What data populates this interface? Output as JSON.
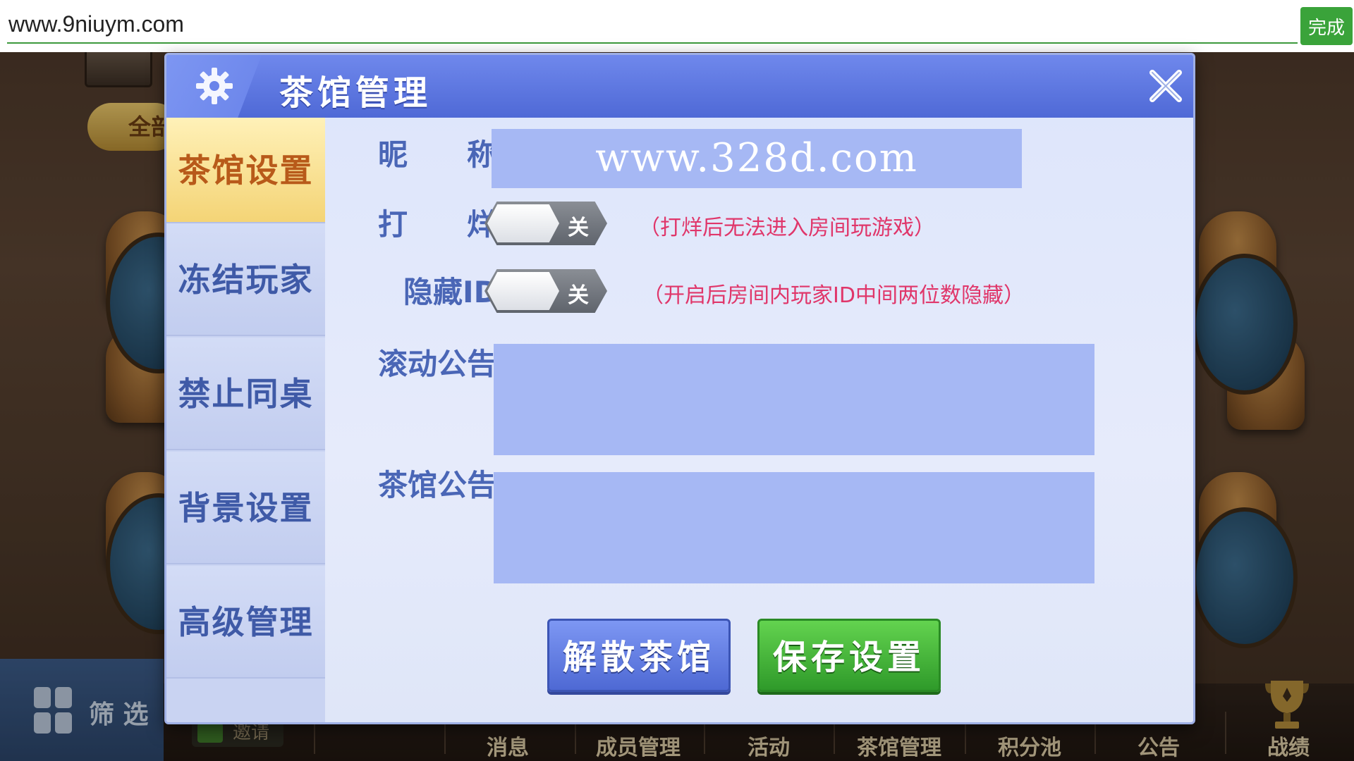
{
  "browser": {
    "url": "www.9niuym.com",
    "done_label": "完成"
  },
  "background": {
    "all_label": "全部",
    "filter_label": "筛 选",
    "invite_label": "邀请",
    "bottom_nav": [
      "消息",
      "成员管理",
      "活动",
      "茶馆管理",
      "积分池",
      "公告",
      "战绩"
    ]
  },
  "modal": {
    "title": "茶馆管理",
    "tabs": [
      "茶馆设置",
      "冻结玩家",
      "禁止同桌",
      "背景设置",
      "高级管理"
    ],
    "active_tab_index": 0,
    "form": {
      "nickname_label": "昵　　称",
      "nickname_value": "www.328d.com",
      "closed_label": "打　　烊",
      "closed_state": "关",
      "closed_hint": "（打烊后无法进入房间玩游戏）",
      "hide_id_label": "隐藏ID",
      "hide_id_state": "关",
      "hide_id_hint": "（开启后房间内玩家ID中间两位数隐藏）",
      "scroll_notice_label": "滚动公告",
      "scroll_notice_value": "",
      "house_notice_label": "茶馆公告",
      "house_notice_value": ""
    },
    "buttons": {
      "disband": "解散茶馆",
      "save": "保存设置"
    }
  },
  "colors": {
    "header_blue": "#5570dc",
    "active_tab": "#f4d476",
    "hint_red": "#e0366a",
    "save_green": "#2f9a2a"
  }
}
